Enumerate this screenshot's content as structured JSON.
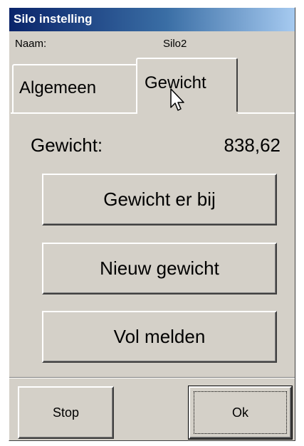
{
  "window": {
    "title": "Silo instelling"
  },
  "name_row": {
    "label": "Naam:",
    "value": "Silo2"
  },
  "tabs": [
    {
      "label": "Algemeen",
      "active": false
    },
    {
      "label": "Gewicht",
      "active": true
    }
  ],
  "weight": {
    "label": "Gewicht:",
    "value": "838,62"
  },
  "actions": [
    {
      "label": "Gewicht er bij"
    },
    {
      "label": "Nieuw gewicht"
    },
    {
      "label": "Vol melden"
    }
  ],
  "footer": {
    "stop_label": "Stop",
    "ok_label": "Ok"
  },
  "icons": {
    "cursor": "arrow-cursor-icon"
  }
}
